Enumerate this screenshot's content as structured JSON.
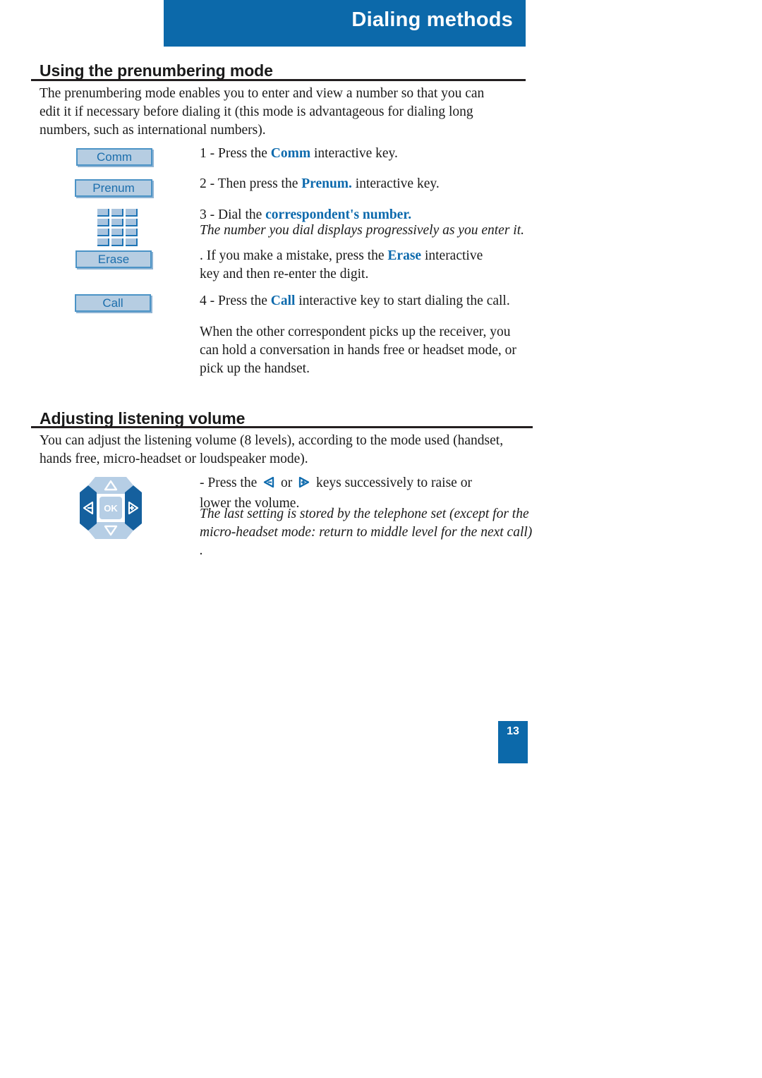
{
  "header": {
    "title": "Dialing methods"
  },
  "sections": [
    {
      "heading": "Using the prenumbering mode",
      "intro": "The prenumbering mode enables you to enter and view a number so that you can edit it if necessary before dialing it (this mode is advantageous for dialing long numbers, such as international numbers).",
      "steps": [
        {
          "key_label": "Comm",
          "prefix": "1 - Press the ",
          "emphasis": "Comm",
          "suffix": " interactive key."
        },
        {
          "key_label": "Prenum",
          "prefix": "2 - Then press the ",
          "emphasis": "Prenum.",
          "suffix": " interactive key."
        },
        {
          "key_label": "keypad-icon",
          "prefix": "3 - Dial the ",
          "emphasis": "correspondent's number.",
          "suffix": "",
          "note": "The number you dial displays progressively as you enter it."
        },
        {
          "key_label": "Erase",
          "prefix": ". If you make a mistake, press the ",
          "emphasis": "Erase",
          "suffix": " interactive key and then re-enter the digit."
        },
        {
          "key_label": "Call",
          "prefix": "4 - Press the ",
          "emphasis": "Call",
          "suffix": " interactive key to start dialing the call."
        }
      ],
      "closing": "When the other correspondent picks up the receiver, you can hold a conversation in hands free or headset mode, or pick up the handset."
    },
    {
      "heading": "Adjusting listening volume",
      "intro": "You can adjust the listening volume (8 levels), according to the mode used (handset, hands free, micro-headset or loudspeaker mode).",
      "instruction_prefix": "- Press the ",
      "instruction_middle": " or ",
      "instruction_suffix": " keys successively to raise or lower the volume.",
      "note": "The last setting is stored by the telephone set (except for the micro-headset mode: return to middle level for the next call) ."
    }
  ],
  "navpad": {
    "ok_label": "OK",
    "volume_down_label": "−",
    "volume_up_label": "+"
  },
  "page_number": "13",
  "colors": {
    "brand_blue": "#0C69AA",
    "key_fill": "#B6CDE2",
    "key_border": "#4B93C6",
    "key_text": "#1C6EAC",
    "emphasis_blue": "#0D6AAD",
    "navpad_dark": "#15609E",
    "navpad_light": "#B6CEE5"
  }
}
